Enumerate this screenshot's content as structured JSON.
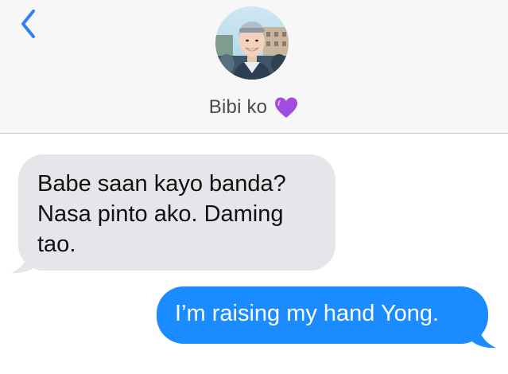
{
  "header": {
    "back_icon": "chevron-left-icon",
    "contact_name": "Bibi ko",
    "contact_emoji": "purple-heart-icon",
    "accent_color": "#2f7ff7"
  },
  "messages": [
    {
      "direction": "incoming",
      "text": "Babe saan kayo banda? Nasa pinto ako. Daming tao.",
      "color": "#e5e5ea"
    },
    {
      "direction": "outgoing",
      "text": "I’m raising my hand Yong.",
      "color": "#1a8cff"
    }
  ]
}
